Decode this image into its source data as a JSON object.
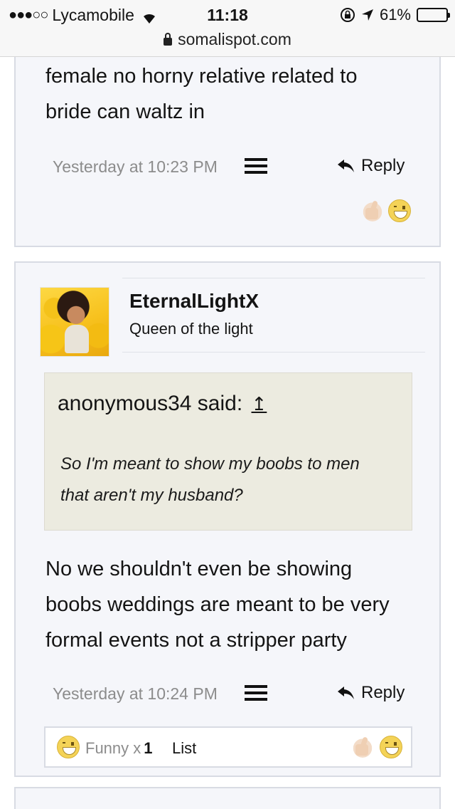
{
  "status_bar": {
    "signal": "●●●○○",
    "carrier": "Lycamobile",
    "time": "11:18",
    "battery": "61%",
    "battery_level": 0.61
  },
  "browser": {
    "url": "somalispot.com"
  },
  "posts": [
    {
      "message_lines": [
        "female no horny relative related to",
        "bride can waltz in"
      ],
      "timestamp": "Yesterday at 10:23 PM",
      "reply_label": "Reply",
      "reactions": [
        "thumbs-up",
        "laughing"
      ]
    },
    {
      "username": "EternalLightX",
      "user_title": "Queen of the light",
      "quote": {
        "author_said": "anonymous34 said:",
        "jump_icon": "↥",
        "lines": [
          "So I'm meant to show my boobs to men",
          "that aren't my husband?"
        ]
      },
      "message_lines": [
        "No we shouldn't even be showing",
        "boobs weddings are meant to be very",
        "formal events not a stripper party"
      ],
      "timestamp": "Yesterday at 10:24 PM",
      "reply_label": "Reply",
      "reaction_summary": {
        "label": "Funny x",
        "count": "1",
        "list_label": "List"
      },
      "reactions": [
        "thumbs-up",
        "laughing"
      ]
    }
  ],
  "colors": {
    "card_bg": "#f5f6fa",
    "card_border": "#d8dbe3",
    "quote_bg": "#ecebe0",
    "meta_text": "#8c8c8c"
  }
}
